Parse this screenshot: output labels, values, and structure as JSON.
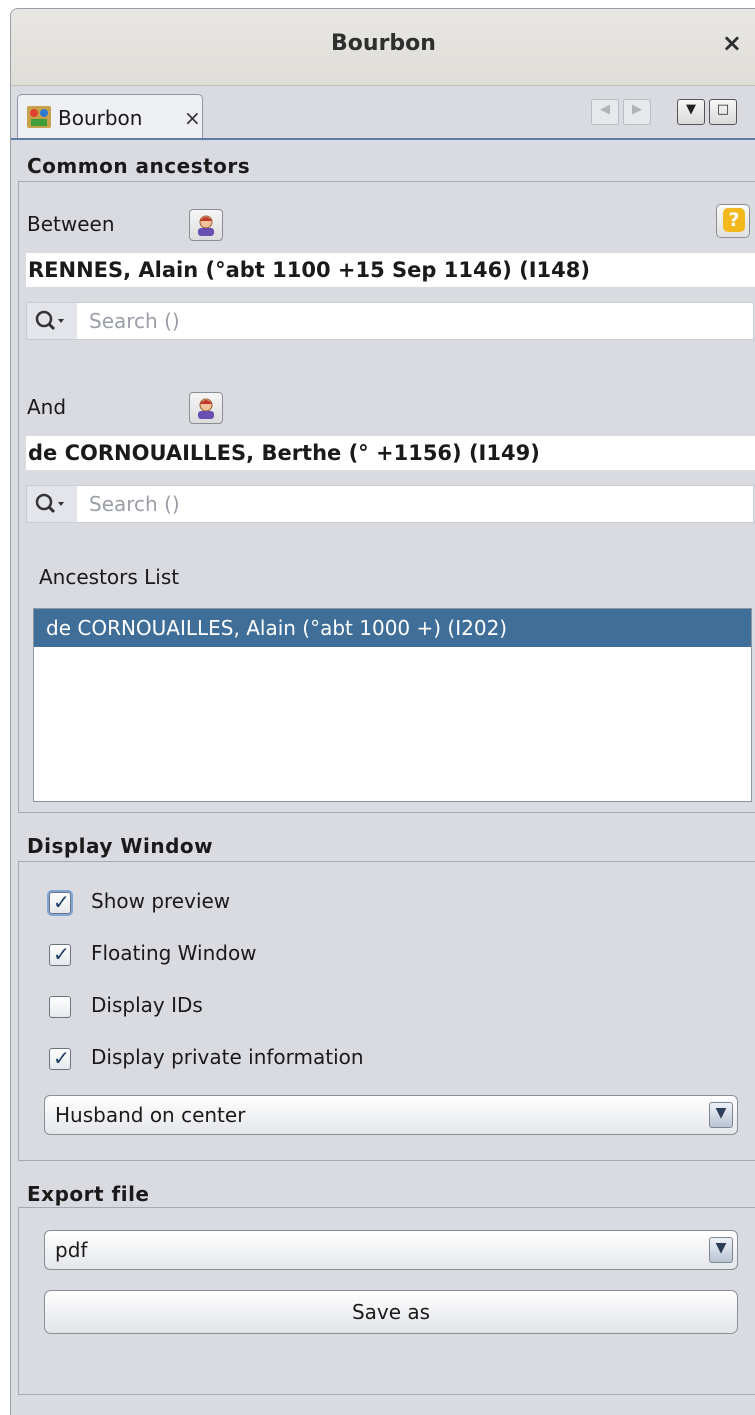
{
  "window": {
    "title": "Bourbon"
  },
  "tab": {
    "label": "Bourbon",
    "close": "×"
  },
  "common": {
    "heading": "Common ancestors",
    "between_label": "Between",
    "person1": "RENNES, Alain (°abt 1100 +15 Sep 1146) (I148)",
    "search1_placeholder": "Search ()",
    "and_label": "And",
    "person2": "de CORNOUAILLES, Berthe (° +1156) (I149)",
    "search2_placeholder": "Search ()",
    "list_label": "Ancestors List",
    "ancestors": [
      "de CORNOUAILLES, Alain (°abt 1000 +) (I202)"
    ],
    "help": "?"
  },
  "display": {
    "heading": "Display Window",
    "options": [
      {
        "label": "Show preview",
        "checked": true
      },
      {
        "label": "Floating Window",
        "checked": true
      },
      {
        "label": "Display IDs",
        "checked": false
      },
      {
        "label": "Display private information",
        "checked": true
      }
    ],
    "layout_value": "Husband on center"
  },
  "export": {
    "heading": "Export file",
    "format_value": "pdf",
    "save_label": "Save as"
  },
  "colors": {
    "selection": "#3f6e99",
    "help_icon": "#f3b81b",
    "tab_underline": "#5a7fa5"
  },
  "icons": [
    "close-icon",
    "tree-icon",
    "person-icon",
    "help-icon",
    "search-icon",
    "dropdown-arrow-icon"
  ]
}
